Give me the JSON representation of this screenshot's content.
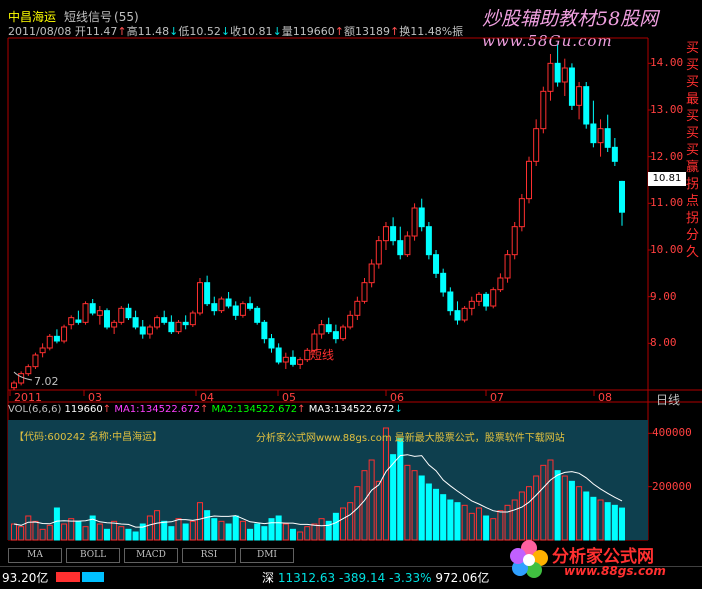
{
  "header": {
    "stock_name": "中昌海运",
    "indicator": "短线信号",
    "indicator_count": "(55)",
    "quote": {
      "date": "2011/08/08",
      "open_label": "开",
      "open": "11.47",
      "open_dir": "↑",
      "high_label": "高",
      "high": "11.48",
      "high_dir": "↓",
      "low_label": "低",
      "low": "10.52",
      "low_dir": "↓",
      "close_label": "收",
      "close": "10.81",
      "close_dir": "↓",
      "volume_label": "量",
      "volume": "119660",
      "volume_dir": "↑",
      "amount_label": "额",
      "amount": "13189",
      "amount_dir": "↑",
      "turnover_label": "换",
      "turnover": "11.48%",
      "amplitude_label": "振"
    }
  },
  "watermark": {
    "line1": "炒股辅助教材58股网",
    "line2": "www.58Gu.com"
  },
  "price_axis": {
    "ticks": [
      "14.00",
      "13.00",
      "12.00",
      "11.00",
      "10.00",
      "9.00",
      "8.00"
    ],
    "current_badge": "10.81"
  },
  "time_axis": {
    "labels": [
      "2011",
      "03",
      "04",
      "05",
      "06",
      "07",
      "08"
    ],
    "period_label": "日线"
  },
  "side_column_text": "买买买最买买买赢拐点拐分久",
  "annotations": {
    "signal_label": "短线",
    "low_price": "7.02"
  },
  "volume_panel": {
    "legend": {
      "title": "VOL(6,6,6)",
      "vol": "119660",
      "vol_dir": "↑",
      "ma1": "MA1:134522.672",
      "ma1_dir": "↑",
      "ma2": "MA2:134522.672",
      "ma2_dir": "↑",
      "ma3": "MA3:134522.672",
      "ma3_dir": "↓"
    },
    "info_left": "【代码:600242 名称:中昌海运】",
    "info_right": "分析家公式网www.88gs.com 最新最大股票公式，股票软件下载网站",
    "ticks": [
      "400000",
      "200000"
    ]
  },
  "tabs": [
    "MA",
    "BOLL",
    "MACD",
    "RSI",
    "DMI"
  ],
  "status_bar": {
    "left": "93.20亿",
    "market": "深",
    "index": "11312.63",
    "change": "-389.14",
    "pct": "-3.33%",
    "amount": "972.06亿"
  },
  "logo": {
    "name": "分析家公式网",
    "url": "www.88gs.com"
  },
  "chart_data": {
    "type": "candlestick",
    "y_range": [
      7.0,
      14.5
    ],
    "candles": [
      [
        7.05,
        7.2,
        7.0,
        7.15
      ],
      [
        7.15,
        7.4,
        7.1,
        7.35
      ],
      [
        7.35,
        7.55,
        7.3,
        7.5
      ],
      [
        7.5,
        7.8,
        7.45,
        7.75
      ],
      [
        7.8,
        8.0,
        7.7,
        7.9
      ],
      [
        7.9,
        8.2,
        7.85,
        8.15
      ],
      [
        8.15,
        8.3,
        8.0,
        8.05
      ],
      [
        8.05,
        8.4,
        8.0,
        8.35
      ],
      [
        8.4,
        8.6,
        8.3,
        8.55
      ],
      [
        8.5,
        8.7,
        8.4,
        8.45
      ],
      [
        8.45,
        8.9,
        8.4,
        8.85
      ],
      [
        8.85,
        8.95,
        8.6,
        8.65
      ],
      [
        8.6,
        8.8,
        8.4,
        8.7
      ],
      [
        8.7,
        8.75,
        8.3,
        8.35
      ],
      [
        8.35,
        8.5,
        8.2,
        8.45
      ],
      [
        8.45,
        8.8,
        8.4,
        8.75
      ],
      [
        8.75,
        8.85,
        8.5,
        8.55
      ],
      [
        8.55,
        8.7,
        8.3,
        8.35
      ],
      [
        8.35,
        8.5,
        8.1,
        8.2
      ],
      [
        8.2,
        8.4,
        8.1,
        8.35
      ],
      [
        8.35,
        8.6,
        8.3,
        8.55
      ],
      [
        8.55,
        8.7,
        8.4,
        8.45
      ],
      [
        8.45,
        8.6,
        8.2,
        8.25
      ],
      [
        8.25,
        8.5,
        8.2,
        8.45
      ],
      [
        8.45,
        8.6,
        8.3,
        8.4
      ],
      [
        8.4,
        8.7,
        8.35,
        8.65
      ],
      [
        8.65,
        9.4,
        8.6,
        9.3
      ],
      [
        9.3,
        9.45,
        8.8,
        8.85
      ],
      [
        8.85,
        9.0,
        8.6,
        8.7
      ],
      [
        8.7,
        9.0,
        8.65,
        8.95
      ],
      [
        8.95,
        9.1,
        8.75,
        8.8
      ],
      [
        8.8,
        8.9,
        8.5,
        8.6
      ],
      [
        8.6,
        8.9,
        8.55,
        8.85
      ],
      [
        8.85,
        9.0,
        8.7,
        8.75
      ],
      [
        8.75,
        8.8,
        8.4,
        8.45
      ],
      [
        8.45,
        8.5,
        8.0,
        8.1
      ],
      [
        8.1,
        8.2,
        7.8,
        7.9
      ],
      [
        7.9,
        8.0,
        7.55,
        7.6
      ],
      [
        7.6,
        7.8,
        7.45,
        7.7
      ],
      [
        7.7,
        7.85,
        7.5,
        7.55
      ],
      [
        7.55,
        7.7,
        7.45,
        7.65
      ],
      [
        7.65,
        7.9,
        7.6,
        7.85
      ],
      [
        7.85,
        8.3,
        7.8,
        8.2
      ],
      [
        8.2,
        8.5,
        8.1,
        8.4
      ],
      [
        8.4,
        8.55,
        8.2,
        8.25
      ],
      [
        8.25,
        8.4,
        8.0,
        8.1
      ],
      [
        8.1,
        8.4,
        8.05,
        8.35
      ],
      [
        8.35,
        8.7,
        8.3,
        8.6
      ],
      [
        8.6,
        9.0,
        8.5,
        8.9
      ],
      [
        8.9,
        9.4,
        8.85,
        9.3
      ],
      [
        9.3,
        9.8,
        9.2,
        9.7
      ],
      [
        9.7,
        10.3,
        9.6,
        10.2
      ],
      [
        10.2,
        10.6,
        10.0,
        10.5
      ],
      [
        10.5,
        10.7,
        10.1,
        10.2
      ],
      [
        10.2,
        10.5,
        9.8,
        9.9
      ],
      [
        9.9,
        10.4,
        9.85,
        10.3
      ],
      [
        10.3,
        11.0,
        10.2,
        10.9
      ],
      [
        10.9,
        11.1,
        10.4,
        10.5
      ],
      [
        10.5,
        10.6,
        9.8,
        9.9
      ],
      [
        9.9,
        10.0,
        9.4,
        9.5
      ],
      [
        9.5,
        9.6,
        9.0,
        9.1
      ],
      [
        9.1,
        9.2,
        8.6,
        8.7
      ],
      [
        8.7,
        8.9,
        8.4,
        8.5
      ],
      [
        8.5,
        8.8,
        8.45,
        8.75
      ],
      [
        8.75,
        9.0,
        8.6,
        8.9
      ],
      [
        8.9,
        9.1,
        8.8,
        9.05
      ],
      [
        9.05,
        9.1,
        8.7,
        8.8
      ],
      [
        8.8,
        9.2,
        8.75,
        9.15
      ],
      [
        9.15,
        9.5,
        9.1,
        9.4
      ],
      [
        9.4,
        10.0,
        9.3,
        9.9
      ],
      [
        9.9,
        10.6,
        9.8,
        10.5
      ],
      [
        10.5,
        11.2,
        10.4,
        11.1
      ],
      [
        11.1,
        12.0,
        11.0,
        11.9
      ],
      [
        11.9,
        12.8,
        11.8,
        12.6
      ],
      [
        12.6,
        13.5,
        12.5,
        13.4
      ],
      [
        13.4,
        14.2,
        13.2,
        14.0
      ],
      [
        14.0,
        14.4,
        13.5,
        13.6
      ],
      [
        13.6,
        14.1,
        13.3,
        13.9
      ],
      [
        13.9,
        14.0,
        13.0,
        13.1
      ],
      [
        13.1,
        13.6,
        12.8,
        13.5
      ],
      [
        13.5,
        13.6,
        12.6,
        12.7
      ],
      [
        12.7,
        13.2,
        12.2,
        12.3
      ],
      [
        12.3,
        12.8,
        12.0,
        12.6
      ],
      [
        12.6,
        12.9,
        12.1,
        12.2
      ],
      [
        12.2,
        12.4,
        11.8,
        11.9
      ],
      [
        11.47,
        11.48,
        10.52,
        10.81
      ]
    ],
    "volume": [
      60000,
      50000,
      90000,
      70000,
      40000,
      55000,
      120000,
      60000,
      80000,
      70000,
      50000,
      90000,
      60000,
      40000,
      70000,
      50000,
      40000,
      30000,
      60000,
      90000,
      110000,
      70000,
      50000,
      80000,
      60000,
      70000,
      140000,
      110000,
      80000,
      70000,
      60000,
      90000,
      70000,
      40000,
      60000,
      50000,
      80000,
      90000,
      60000,
      40000,
      30000,
      50000,
      60000,
      80000,
      70000,
      100000,
      120000,
      140000,
      200000,
      260000,
      300000,
      220000,
      420000,
      320000,
      380000,
      280000,
      260000,
      240000,
      210000,
      190000,
      170000,
      150000,
      140000,
      130000,
      100000,
      120000,
      90000,
      80000,
      110000,
      130000,
      150000,
      180000,
      200000,
      240000,
      280000,
      300000,
      260000,
      240000,
      220000,
      200000,
      180000,
      160000,
      150000,
      140000,
      130000,
      119660
    ],
    "vol_range": [
      0,
      450000
    ]
  }
}
